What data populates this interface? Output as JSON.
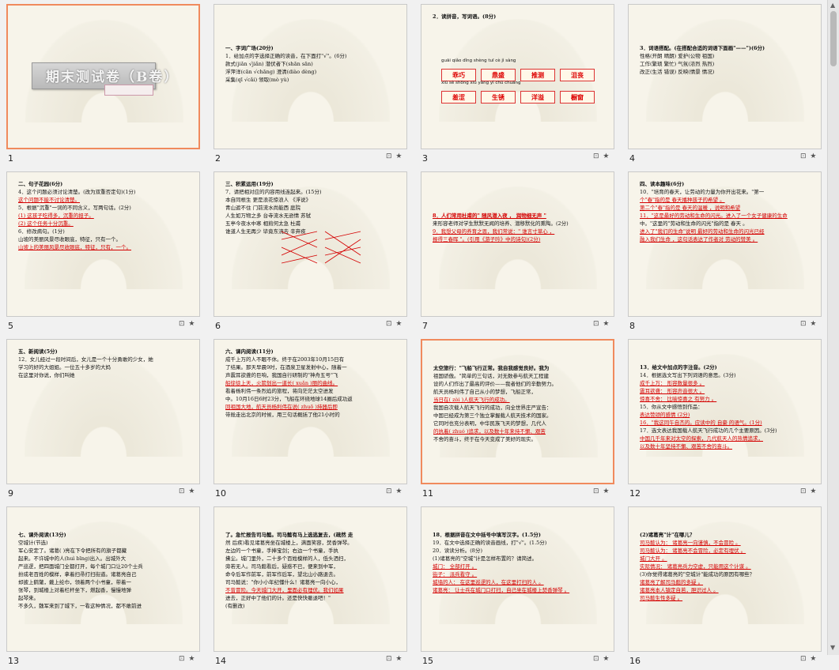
{
  "slides": [
    {
      "num": "1",
      "title": "期末测试卷（B卷）",
      "icons": ""
    },
    {
      "num": "2",
      "icons": "⊡ ★",
      "lines": [
        "一、字词广场(20分)",
        "1．给加点的字选择正确的读音，在下面打\"√\"。(6分)",
        "款式(jiǎn √jiǎn)    潜伏者下(shān  sān)",
        "浮萍洋(cān √chāng)    澄清(diào dèng)",
        "采集(qī  √cǎi)    领取(mò  yù)"
      ]
    },
    {
      "num": "3",
      "icons": "⊡ ★",
      "lines": [
        "2．读拼音，写词语。(8分)"
      ],
      "pinyin1": "guāi qiǎo  dǐng shèng  tuī  cè  jì  sàng",
      "boxes1": [
        "乖巧",
        "鼎盛",
        "推测",
        "沮丧"
      ],
      "pinyin2": "xiū sè   shōng xiū   yǎng yì   chū chuāng",
      "boxes2": [
        "羞涩",
        "生锈",
        "洋溢",
        "橱窗"
      ]
    },
    {
      "num": "4",
      "icons": "⊡ ★",
      "lines": [
        "3．词语搭配。(在搭配合适的词语下面画\"——\")(6分)",
        "性格(开朗  晴朗)    爱护(公物  祖国)",
        "工作(繁琐  繁忙)    气氛(浓烈  热烈)",
        "改正(生活  错误)    反映(情景  情况)"
      ]
    },
    {
      "num": "5",
      "icons": "⊡ ★",
      "lines": [
        "二、句子花园(6分)",
        "4．这个问题必须讨论清楚。(改为双重否定句)(1分)",
        "这个问题不能不讨论清楚。",
        "5．根据\"沉重\"一词的不同含义，写两句话。(2分)",
        "(1) 这孩子吃得多，沉重的担子。",
        "(2) 这个任务十分沉重。",
        "6．修改病句。(1分)",
        "山坡的美丽风景尽收眼底，特征，只有一个。",
        "山坡上的美丽风景尽收眼底，特征，只有，一个。"
      ]
    },
    {
      "num": "6",
      "icons": "⊡ ★",
      "lines": [
        "三、积累运用(19分)",
        "7．请把相对应的内容用线连起来。(15分)",
        "本自同根生    更是浪花惊浪人    《浮说》",
        "青山遮不住    门前流水尚能西    庭院",
        "人生如万物之多    台寺流水无逊情    苏轼",
        "五亭今夜水中寒    相煎何太急    杜甫",
        "谁道人生无再少    毕竟东流去    辛弃疾"
      ]
    },
    {
      "num": "7",
      "icons": "⊡ ★",
      "lines": [
        "8．人们常用杜甫的\"   随风潜入夜   ，   润物细无声   \"",
        "来形容老师对学生默默无闻的培养、潜移默化的熏陶。(2分)",
        "9．我想父母的养育之恩，我们常说：\"   谁言寸草心   ，",
        "   报得三春晖   \"。(引用《游子吟》中的诗句)(2分)"
      ]
    },
    {
      "num": "8",
      "icons": "⊡ ★",
      "lines": [
        "四、读本趣味(6分)",
        "10．\"培育的春天，让劳动的力量为你开出花来。\"第一",
        "个\"春\"指的是  春天播种孩子的希望  。",
        "第二个\"春\"指的是  春天的温暖  ，说明和希望",
        "11．\"这是最好的劳动和生命的闪光。进入了一个女子健康的生命",
        "中。\"这里的\"劳动和生命的闪光\"指的是  春天  。",
        "进入了\"我们的生命\"说明  最好的劳动和生命的闪光已经",
        "融入我们生命  ，这句话表达了作者对  劳动的赞美  。"
      ]
    },
    {
      "num": "9",
      "icons": "⊡ ★",
      "lines": [
        "五、新阅读(5分)",
        "12．女儿经过一段时间后，女儿是一个十分勇敢的少女，她",
        "学习的好的大姐姐。一位五十多岁的大妈",
        "在这里对你说，你们叫她"
      ]
    },
    {
      "num": "10",
      "icons": "⊡ ★",
      "lines": [
        "六、课内阅读(11分)",
        "成千上万的人不眠不休。终于在2003年10月15日有",
        "了结果。那天早晨9时，在酒泉卫星发射中心，随着一",
        "声震耳欲聋的巨响，我国自行研制的\"神舟五号\"飞",
        "船徐徐上天，火箭划出一道长(  xuǎn  )丽的曲线。",
        "看着杨利伟一条烈焰的旅程，将向茫茫太空进发",
        "中。10月16日6时23分，飞船在环绕地球14圈后成功返",
        "回祖国大地，航天员杨利伟在说(  zhuō  )持器后即",
        "带舱走出北京的时候，用三句话概括了他21小时的"
      ]
    },
    {
      "num": "11",
      "icons": "⊡ ★",
      "lines": [
        "太空旅行：\"飞船飞行正常。我自我感觉良好。我为",
        "祖国骄傲。\"简单的三句话，对无数参与航天工程建",
        "设的人们作出了最高的评价——我者他们的辛勤努力。",
        "航天员杨利伟了自己从小的梦想，飞船正常，",
        "当日在(   zòi   )人航天飞行的成功。",
        "我国自次载人航天飞行的成功，向全世界庄严宣告：",
        "中国已经成为第三个独立掌握载人航天技术的国家。",
        "它同时也充分表明，中华民族飞天的梦想，几代人",
        "的执着(   zhuó   )追求，以及数十年来持不懈、艰苦",
        "不舍的奋斗，终于在今天变成了美好的现实。"
      ]
    },
    {
      "num": "12",
      "icons": "⊡ ★",
      "lines": [
        "13．给文中加点的字注音。(2分)",
        "14．根据选文写出下列词语的意思。(3分)",
        "成千上万：  形容数量很多  。",
        "震耳欲聋：  形容声音很大  。",
        "惊喜不舍：  比喻惊喜之  有努力  。",
        "15．你从文中感悟到作品：",
        "   表达赞颂的感情  (2分)",
        "16．\"我这同午自杰的。应读中的  自豪  的语气。(1分)",
        "17．选文表达我国载人航天飞行成功的几个主要原因。(3分)",
        "中国几千年来对太空的探索，几代航天人的热情追求，",
        "以及数十年坚持不懈、艰苦不舍的奋斗。"
      ]
    },
    {
      "num": "13",
      "icons": "⊡ ★",
      "lines": [
        "七、课外阅读(13分)",
        "空城计(节选)",
        "军心安定了。诸葛(   )亮在下令把所有的旗子都藏",
        "起来。不许城中的人(huì  bīng)出入。出城外大",
        "严巡逻，把四面城门全都打开，每个城门口让20个士兵",
        "扮成老百姓的模样，拿着扫帚打扫街道。诸葛亮自己",
        "却披上鹤氅，戴上纶巾，领着两个小书童，带着一",
        "张琴，到城楼上对着栏杆坐下，燃起香，慢慢地弹",
        "起琴来。",
        "不多久，魏军来到了城下，一看这种情况，都不敢前进"
      ]
    },
    {
      "num": "14",
      "icons": "⊡ ★",
      "lines": [
        "了。急忙报告司马懿。司马懿有马上选逃复去，(疏然  走",
        "然   后疾)看见诸葛亮坐在城楼上，满面笑容，焚香弹琴。",
        "左边的一个书童，手捧宝剑；右边一个书童，手执",
        "拂尘。城门里外，二十多个百姓模样的人，低头洒扫，",
        "旁若无人。司马懿看后，疑惑不已，便来到中军，",
        "命令后军作前军，前军作后军，望北山小路退去。",
        "司马懿说：\"你小小年纪懂什么！诸葛亮一向小心，",
        "不曾冒险。今天城门大开，里面必有埋伏。我们如果",
        "进去，正好中了他们的计。还是快快撤退吧！\"",
        "(有删改)"
      ]
    },
    {
      "num": "15",
      "icons": "⊡ ★",
      "lines": [
        "18．根据拼音在文中括号中填写汉字。(1.5分)",
        "19．在文中选择正确的读音画线，打\"√\"。(1.5分)",
        "20．读读分析。(8分)",
        "(1)诸葛亮的\"空城\"计是怎样布置的？请简述。",
        "城门：  全部打开  。",
        "街子：  派兵看守  。",
        "城墙的人：  在这里巡逻的人，在这里打扫的人  。",
        "诸葛亮：  让士兵在城门口打扫，自己坐在城楼上焚香弹琴  。"
      ]
    },
    {
      "num": "16",
      "icons": "⊡ ★",
      "lines": [
        "(2)诸葛亮\"计\"在哪儿？",
        "司马懿认为：  诸葛亮一向谨慎，不会冒险  。",
        "司马懿认为：  诸葛亮不会冒险，必定有埋伏  。",
        "  城门大开  。",
        "实际情况：  诸葛亮兵力空虚，只能用这个计谋  。",
        "(3)你觉得诸葛亮的\"空城计\"能成功的原因有哪些？",
        "  诸葛亮了解司马懿的多疑  。",
        "  诸葛亮本人镇定自若，胆识过人  。",
        "  司马懿生性多疑  。"
      ]
    }
  ]
}
